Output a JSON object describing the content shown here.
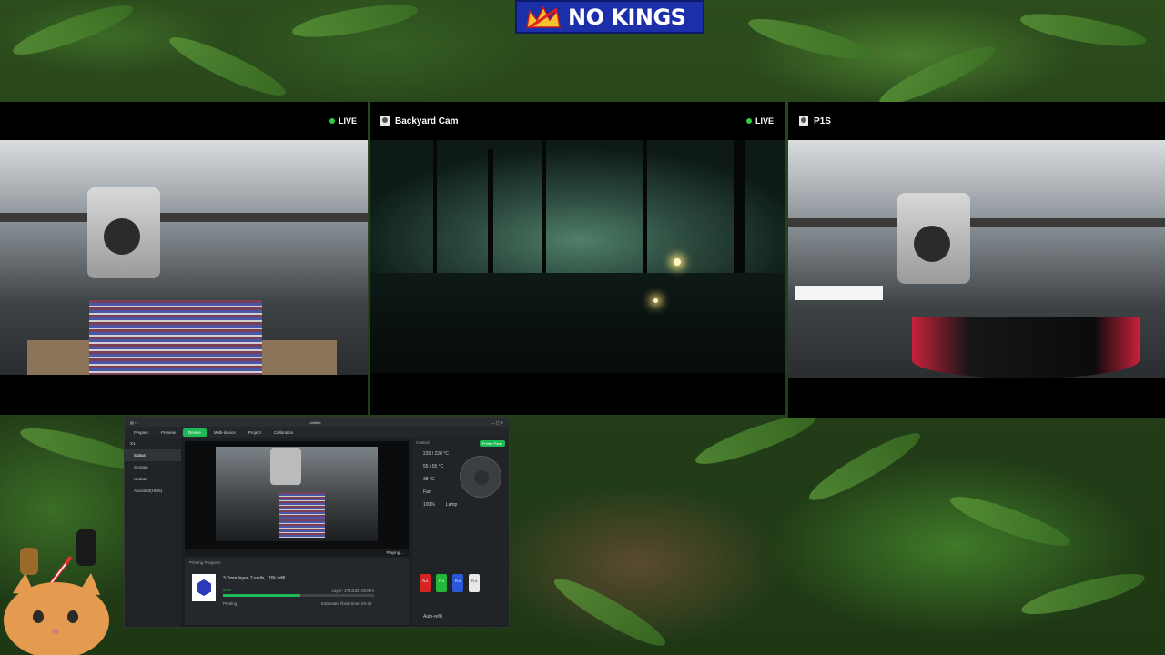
{
  "banner": {
    "text": "NO KINGS",
    "color": "#1b2fa8"
  },
  "cameras": [
    {
      "name": "",
      "live": "LIVE",
      "feed": "printer-x1-tall-print"
    },
    {
      "name": "Backyard Cam",
      "live": "LIVE",
      "feed": "backyard-night"
    },
    {
      "name": "P1S",
      "live": "",
      "feed": "printer-p1s-pot"
    }
  ],
  "app": {
    "window_title": "Untitled",
    "tabs": [
      "Prepare",
      "Preview",
      "Device",
      "Multi-device",
      "Project",
      "Calibration"
    ],
    "active_tab": "Device",
    "printer_name": "X1",
    "sidebar": [
      "Status",
      "Storage",
      "Update",
      "Assistant(HMS)"
    ],
    "playing_label": "Playing...",
    "printing_progress_label": "Printing Progress",
    "job_name": "3.2mm layer, 2 walls, 10% infill",
    "percent": "51%",
    "status": "Printing",
    "layer": "Layer: 271/532",
    "remaining": "-2h36m",
    "finish_time": "Estimated finish time: 04-22",
    "progress": 0.51,
    "control_label": "Control",
    "printer_parts_label": "Printer Parts",
    "temps": [
      "220 / 220 °C",
      "55 / 55 °C",
      "38 °C"
    ],
    "fan_label": "Fan",
    "lamp_label": "Lamp",
    "speed_label": "100%",
    "ams_slots": [
      {
        "label": "PLA",
        "color": "#d42424"
      },
      {
        "label": "PLA",
        "color": "#22b83c"
      },
      {
        "label": "PLA",
        "color": "#2a58d8"
      },
      {
        "label": "PLA",
        "color": "#e8e8e8"
      }
    ],
    "auto_refill": "Auto-refill",
    "accent": "#1db954"
  }
}
